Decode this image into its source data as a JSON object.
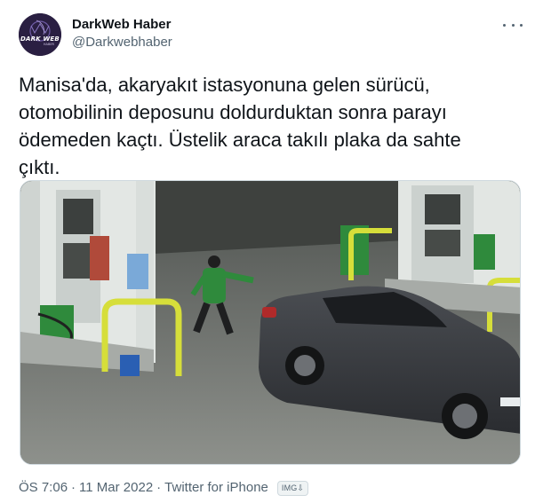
{
  "author": {
    "display_name": "DarkWeb Haber",
    "handle": "@Darkwebhaber",
    "avatar_text": "DARK WEB",
    "avatar_subtext": "HABER"
  },
  "tweet": {
    "text": "Manisa'da, akaryakıt istasyonuna gelen sürücü,\notomobilinin deposunu doldurduktan sonra parayı\nödemeden kaçtı. Üstelik araca takılı plaka da sahte\nçıktı."
  },
  "meta": {
    "time": "ÖS 7:06",
    "date": "11 Mar 2022",
    "source": "Twitter for iPhone",
    "badge": "IMG⇩"
  },
  "colors": {
    "primary_text": "#0f1419",
    "secondary_text": "#536471",
    "border": "#cfd9de",
    "station_green": "#2f8a3c"
  },
  "icons": {
    "more": "more-horizontal-icon"
  }
}
